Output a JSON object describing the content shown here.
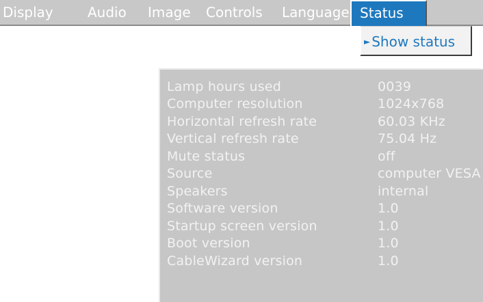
{
  "menubar": {
    "items": [
      {
        "label": "Display"
      },
      {
        "label": "Audio"
      },
      {
        "label": "Image"
      },
      {
        "label": "Controls"
      },
      {
        "label": "Language"
      },
      {
        "label": "Status"
      }
    ],
    "active_index": 5
  },
  "submenu": {
    "arrow_icon": "triangle-right-icon",
    "item_label": "Show status"
  },
  "status": {
    "rows": [
      {
        "label": "Lamp hours used",
        "value": "0039"
      },
      {
        "label": "Computer resolution",
        "value": "1024x768"
      },
      {
        "label": "Horizontal refresh rate",
        "value": "60.03 KHz"
      },
      {
        "label": "Vertical refresh rate",
        "value": "75.04 Hz"
      },
      {
        "label": "Mute status",
        "value": "off"
      },
      {
        "label": "Source",
        "value": "computer VESA"
      },
      {
        "label": "Speakers",
        "value": "internal"
      },
      {
        "label": "Software version",
        "value": "1.0"
      },
      {
        "label": "Startup screen version",
        "value": "1.0"
      },
      {
        "label": "Boot version",
        "value": "1.0"
      },
      {
        "label": "CableWizard version",
        "value": "1.0"
      }
    ]
  },
  "colors": {
    "menu_bg": "#c8c8c8",
    "accent": "#1e78be",
    "panel_bg": "#c6c6c6",
    "text_light": "#f2f2f2"
  }
}
